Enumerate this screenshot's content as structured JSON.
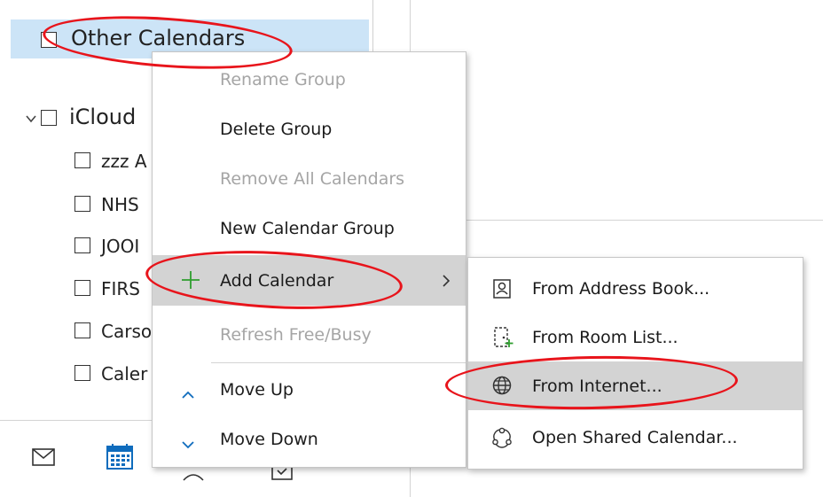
{
  "sidebar": {
    "selected_group": "Other Calendars",
    "icloud_group": "iCloud",
    "calendars": [
      "zzz A",
      "NHS",
      "JOOI",
      "FIRS",
      "Carso",
      "Caler"
    ]
  },
  "context_menu": {
    "items": [
      {
        "label": "Rename Group",
        "enabled": false
      },
      {
        "label": "Delete Group",
        "enabled": true
      },
      {
        "label": "Remove All Calendars",
        "enabled": false
      },
      {
        "label": "New Calendar Group",
        "enabled": true
      },
      {
        "label": "Add Calendar",
        "enabled": true
      },
      {
        "label": "Refresh Free/Busy",
        "enabled": false
      },
      {
        "label": "Move Up",
        "enabled": true
      },
      {
        "label": "Move Down",
        "enabled": true
      }
    ]
  },
  "submenu": {
    "items": [
      {
        "label": "From Address Book...",
        "icon": "address-book-icon"
      },
      {
        "label": "From Room List...",
        "icon": "room-list-icon"
      },
      {
        "label": "From Internet...",
        "icon": "globe-icon"
      },
      {
        "label": "Open Shared Calendar...",
        "icon": "shared-calendar-icon"
      }
    ]
  },
  "colors": {
    "selection": "#cce4f7",
    "hover": "#d3d3d3",
    "annotation": "#e8141b",
    "accent": "#0f6cbd",
    "add_green": "#2e9e2e"
  }
}
